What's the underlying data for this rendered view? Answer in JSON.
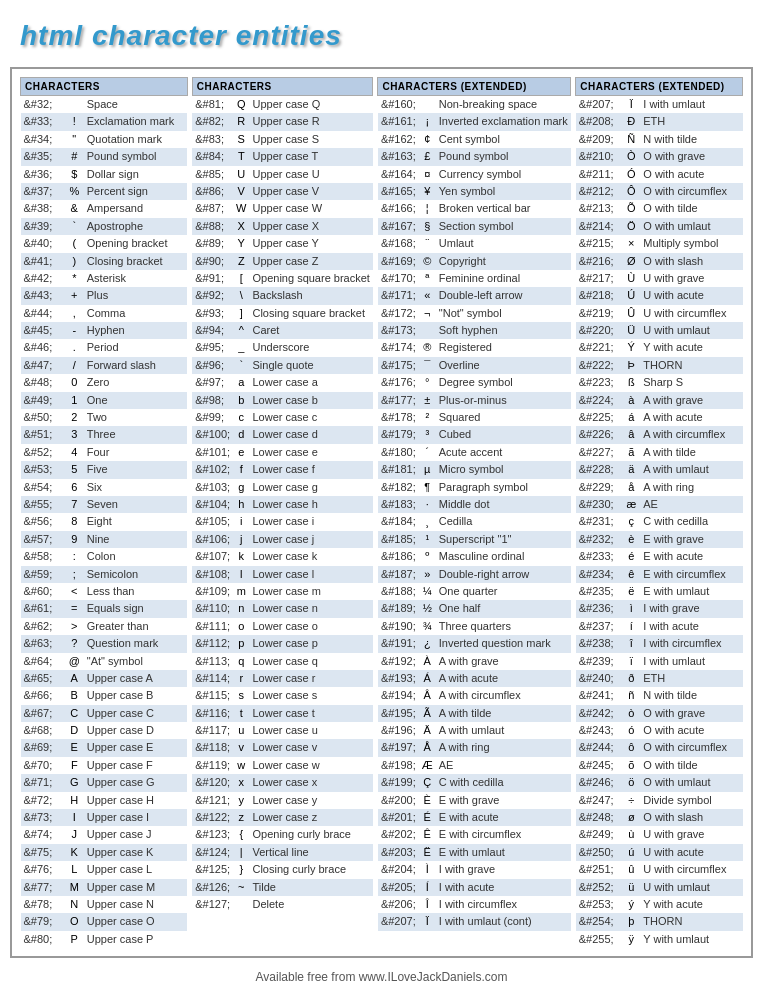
{
  "title": "html character entities",
  "footer": "Available free from www.ILoveJackDaniels.com",
  "columns": [
    {
      "header": "CHARACTERS",
      "rows": [
        [
          "&#32;",
          "",
          "Space"
        ],
        [
          "&#33;",
          "!",
          "Exclamation mark"
        ],
        [
          "&#34;",
          "\"",
          "Quotation mark"
        ],
        [
          "&#35;",
          "#",
          "Pound symbol"
        ],
        [
          "&#36;",
          "$",
          "Dollar sign"
        ],
        [
          "&#37;",
          "%",
          "Percent sign"
        ],
        [
          "&#38;",
          "&",
          "Ampersand"
        ],
        [
          "&#39;",
          "`",
          "Apostrophe"
        ],
        [
          "&#40;",
          "(",
          "Opening bracket"
        ],
        [
          "&#41;",
          ")",
          "Closing bracket"
        ],
        [
          "&#42;",
          "*",
          "Asterisk"
        ],
        [
          "&#43;",
          "+",
          "Plus"
        ],
        [
          "&#44;",
          ",",
          "Comma"
        ],
        [
          "&#45;",
          "-",
          "Hyphen"
        ],
        [
          "&#46;",
          ".",
          "Period"
        ],
        [
          "&#47;",
          "/",
          "Forward slash"
        ],
        [
          "&#48;",
          "0",
          "Zero"
        ],
        [
          "&#49;",
          "1",
          "One"
        ],
        [
          "&#50;",
          "2",
          "Two"
        ],
        [
          "&#51;",
          "3",
          "Three"
        ],
        [
          "&#52;",
          "4",
          "Four"
        ],
        [
          "&#53;",
          "5",
          "Five"
        ],
        [
          "&#54;",
          "6",
          "Six"
        ],
        [
          "&#55;",
          "7",
          "Seven"
        ],
        [
          "&#56;",
          "8",
          "Eight"
        ],
        [
          "&#57;",
          "9",
          "Nine"
        ],
        [
          "&#58;",
          ":",
          "Colon"
        ],
        [
          "&#59;",
          ";",
          "Semicolon"
        ],
        [
          "&#60;",
          "<",
          "Less than"
        ],
        [
          "&#61;",
          "=",
          "Equals sign"
        ],
        [
          "&#62;",
          ">",
          "Greater than"
        ],
        [
          "&#63;",
          "?",
          "Question mark"
        ],
        [
          "&#64;",
          "@",
          "\"At\" symbol"
        ],
        [
          "&#65;",
          "A",
          "Upper case A"
        ],
        [
          "&#66;",
          "B",
          "Upper case B"
        ],
        [
          "&#67;",
          "C",
          "Upper case C"
        ],
        [
          "&#68;",
          "D",
          "Upper case D"
        ],
        [
          "&#69;",
          "E",
          "Upper case E"
        ],
        [
          "&#70;",
          "F",
          "Upper case F"
        ],
        [
          "&#71;",
          "G",
          "Upper case G"
        ],
        [
          "&#72;",
          "H",
          "Upper case H"
        ],
        [
          "&#73;",
          "I",
          "Upper case I"
        ],
        [
          "&#74;",
          "J",
          "Upper case J"
        ],
        [
          "&#75;",
          "K",
          "Upper case K"
        ],
        [
          "&#76;",
          "L",
          "Upper case L"
        ],
        [
          "&#77;",
          "M",
          "Upper case M"
        ],
        [
          "&#78;",
          "N",
          "Upper case N"
        ],
        [
          "&#79;",
          "O",
          "Upper case O"
        ],
        [
          "&#80;",
          "P",
          "Upper case P"
        ]
      ]
    },
    {
      "header": "CHARACTERS",
      "rows": [
        [
          "&#81;",
          "Q",
          "Upper case Q"
        ],
        [
          "&#82;",
          "R",
          "Upper case R"
        ],
        [
          "&#83;",
          "S",
          "Upper case S"
        ],
        [
          "&#84;",
          "T",
          "Upper case T"
        ],
        [
          "&#85;",
          "U",
          "Upper case U"
        ],
        [
          "&#86;",
          "V",
          "Upper case V"
        ],
        [
          "&#87;",
          "W",
          "Upper case W"
        ],
        [
          "&#88;",
          "X",
          "Upper case X"
        ],
        [
          "&#89;",
          "Y",
          "Upper case Y"
        ],
        [
          "&#90;",
          "Z",
          "Upper case Z"
        ],
        [
          "&#91;",
          "[",
          "Opening square bracket"
        ],
        [
          "&#92;",
          "\\",
          "Backslash"
        ],
        [
          "&#93;",
          "]",
          "Closing square bracket"
        ],
        [
          "&#94;",
          "^",
          "Caret"
        ],
        [
          "&#95;",
          "_",
          "Underscore"
        ],
        [
          "&#96;",
          "`",
          "Single quote"
        ],
        [
          "&#97;",
          "a",
          "Lower case a"
        ],
        [
          "&#98;",
          "b",
          "Lower case b"
        ],
        [
          "&#99;",
          "c",
          "Lower case c"
        ],
        [
          "&#100;",
          "d",
          "Lower case d"
        ],
        [
          "&#101;",
          "e",
          "Lower case e"
        ],
        [
          "&#102;",
          "f",
          "Lower case f"
        ],
        [
          "&#103;",
          "g",
          "Lower case g"
        ],
        [
          "&#104;",
          "h",
          "Lower case h"
        ],
        [
          "&#105;",
          "i",
          "Lower case i"
        ],
        [
          "&#106;",
          "j",
          "Lower case j"
        ],
        [
          "&#107;",
          "k",
          "Lower case k"
        ],
        [
          "&#108;",
          "l",
          "Lower case l"
        ],
        [
          "&#109;",
          "m",
          "Lower case m"
        ],
        [
          "&#110;",
          "n",
          "Lower case n"
        ],
        [
          "&#111;",
          "o",
          "Lower case o"
        ],
        [
          "&#112;",
          "p",
          "Lower case p"
        ],
        [
          "&#113;",
          "q",
          "Lower case q"
        ],
        [
          "&#114;",
          "r",
          "Lower case r"
        ],
        [
          "&#115;",
          "s",
          "Lower case s"
        ],
        [
          "&#116;",
          "t",
          "Lower case t"
        ],
        [
          "&#117;",
          "u",
          "Lower case u"
        ],
        [
          "&#118;",
          "v",
          "Lower case v"
        ],
        [
          "&#119;",
          "w",
          "Lower case w"
        ],
        [
          "&#120;",
          "x",
          "Lower case x"
        ],
        [
          "&#121;",
          "y",
          "Lower case y"
        ],
        [
          "&#122;",
          "z",
          "Lower case z"
        ],
        [
          "&#123;",
          "{",
          "Opening curly brace"
        ],
        [
          "&#124;",
          "|",
          "Vertical line"
        ],
        [
          "&#125;",
          "}",
          "Closing curly brace"
        ],
        [
          "&#126;",
          "~",
          "Tilde"
        ],
        [
          "&#127;",
          "",
          "Delete"
        ]
      ]
    },
    {
      "header": "CHARACTERS (EXTENDED)",
      "rows": [
        [
          "&#160;",
          "",
          "Non-breaking space"
        ],
        [
          "&#161;",
          "¡",
          "Inverted exclamation mark"
        ],
        [
          "&#162;",
          "¢",
          "Cent symbol"
        ],
        [
          "&#163;",
          "£",
          "Pound symbol"
        ],
        [
          "&#164;",
          "¤",
          "Currency symbol"
        ],
        [
          "&#165;",
          "¥",
          "Yen symbol"
        ],
        [
          "&#166;",
          "¦",
          "Broken vertical bar"
        ],
        [
          "&#167;",
          "§",
          "Section symbol"
        ],
        [
          "&#168;",
          "¨",
          "Umlaut"
        ],
        [
          "&#169;",
          "©",
          "Copyright"
        ],
        [
          "&#170;",
          "ª",
          "Feminine ordinal"
        ],
        [
          "&#171;",
          "«",
          "Double-left arrow"
        ],
        [
          "&#172;",
          "¬",
          "\"Not\" symbol"
        ],
        [
          "&#173;",
          "",
          "Soft hyphen"
        ],
        [
          "&#174;",
          "®",
          "Registered"
        ],
        [
          "&#175;",
          "¯",
          "Overline"
        ],
        [
          "&#176;",
          "°",
          "Degree symbol"
        ],
        [
          "&#177;",
          "±",
          "Plus-or-minus"
        ],
        [
          "&#178;",
          "²",
          "Squared"
        ],
        [
          "&#179;",
          "³",
          "Cubed"
        ],
        [
          "&#180;",
          "´",
          "Acute accent"
        ],
        [
          "&#181;",
          "µ",
          "Micro symbol"
        ],
        [
          "&#182;",
          "¶",
          "Paragraph symbol"
        ],
        [
          "&#183;",
          "·",
          "Middle dot"
        ],
        [
          "&#184;",
          "¸",
          "Cedilla"
        ],
        [
          "&#185;",
          "¹",
          "Superscript \"1\""
        ],
        [
          "&#186;",
          "º",
          "Masculine ordinal"
        ],
        [
          "&#187;",
          "»",
          "Double-right arrow"
        ],
        [
          "&#188;",
          "¼",
          "One quarter"
        ],
        [
          "&#189;",
          "½",
          "One half"
        ],
        [
          "&#190;",
          "¾",
          "Three quarters"
        ],
        [
          "&#191;",
          "¿",
          "Inverted question mark"
        ],
        [
          "&#192;",
          "À",
          "A with grave"
        ],
        [
          "&#193;",
          "Á",
          "A with acute"
        ],
        [
          "&#194;",
          "Â",
          "A with circumflex"
        ],
        [
          "&#195;",
          "Ã",
          "A with tilde"
        ],
        [
          "&#196;",
          "Ä",
          "A with umlaut"
        ],
        [
          "&#197;",
          "Å",
          "A with ring"
        ],
        [
          "&#198;",
          "Æ",
          "AE"
        ],
        [
          "&#199;",
          "Ç",
          "C with cedilla"
        ],
        [
          "&#200;",
          "È",
          "E with grave"
        ],
        [
          "&#201;",
          "É",
          "E with acute"
        ],
        [
          "&#202;",
          "Ê",
          "E with circumflex"
        ],
        [
          "&#203;",
          "Ë",
          "E with umlaut"
        ],
        [
          "&#204;",
          "Ì",
          "I with grave"
        ],
        [
          "&#205;",
          "Í",
          "I with acute"
        ],
        [
          "&#206;",
          "Î",
          "I with circumflex"
        ],
        [
          "&#207;",
          "Ï",
          "I with umlaut (cont)"
        ]
      ]
    },
    {
      "header": "CHARACTERS (EXTENDED)",
      "rows": [
        [
          "&#207;",
          "Ï",
          "I with umlaut"
        ],
        [
          "&#208;",
          "Ð",
          "ETH"
        ],
        [
          "&#209;",
          "Ñ",
          "N with tilde"
        ],
        [
          "&#210;",
          "Ò",
          "O with grave"
        ],
        [
          "&#211;",
          "Ó",
          "O with acute"
        ],
        [
          "&#212;",
          "Ô",
          "O with circumflex"
        ],
        [
          "&#213;",
          "Õ",
          "O with tilde"
        ],
        [
          "&#214;",
          "Ö",
          "O with umlaut"
        ],
        [
          "&#215;",
          "×",
          "Multiply symbol"
        ],
        [
          "&#216;",
          "Ø",
          "O with slash"
        ],
        [
          "&#217;",
          "Ù",
          "U with grave"
        ],
        [
          "&#218;",
          "Ú",
          "U with acute"
        ],
        [
          "&#219;",
          "Û",
          "U with circumflex"
        ],
        [
          "&#220;",
          "Ü",
          "U with umlaut"
        ],
        [
          "&#221;",
          "Ý",
          "Y with acute"
        ],
        [
          "&#222;",
          "Þ",
          "THORN"
        ],
        [
          "&#223;",
          "ß",
          "Sharp S"
        ],
        [
          "&#224;",
          "à",
          "A with grave"
        ],
        [
          "&#225;",
          "á",
          "A with acute"
        ],
        [
          "&#226;",
          "â",
          "A with circumflex"
        ],
        [
          "&#227;",
          "ã",
          "A with tilde"
        ],
        [
          "&#228;",
          "ä",
          "A with umlaut"
        ],
        [
          "&#229;",
          "å",
          "A with ring"
        ],
        [
          "&#230;",
          "æ",
          "AE"
        ],
        [
          "&#231;",
          "ç",
          "C with cedilla"
        ],
        [
          "&#232;",
          "è",
          "E with grave"
        ],
        [
          "&#233;",
          "é",
          "E with acute"
        ],
        [
          "&#234;",
          "ê",
          "E with circumflex"
        ],
        [
          "&#235;",
          "ë",
          "E with umlaut"
        ],
        [
          "&#236;",
          "ì",
          "I with grave"
        ],
        [
          "&#237;",
          "í",
          "I with acute"
        ],
        [
          "&#238;",
          "î",
          "I with circumflex"
        ],
        [
          "&#239;",
          "ï",
          "I with umlaut"
        ],
        [
          "&#240;",
          "ð",
          "ETH"
        ],
        [
          "&#241;",
          "ñ",
          "N with tilde"
        ],
        [
          "&#242;",
          "ò",
          "O with grave"
        ],
        [
          "&#243;",
          "ó",
          "O with acute"
        ],
        [
          "&#244;",
          "ô",
          "O with circumflex"
        ],
        [
          "&#245;",
          "õ",
          "O with tilde"
        ],
        [
          "&#246;",
          "ö",
          "O with umlaut"
        ],
        [
          "&#247;",
          "÷",
          "Divide symbol"
        ],
        [
          "&#248;",
          "ø",
          "O with slash"
        ],
        [
          "&#249;",
          "ù",
          "U with grave"
        ],
        [
          "&#250;",
          "ú",
          "U with acute"
        ],
        [
          "&#251;",
          "û",
          "U with circumflex"
        ],
        [
          "&#252;",
          "ü",
          "U with umlaut"
        ],
        [
          "&#253;",
          "ý",
          "Y with acute"
        ],
        [
          "&#254;",
          "þ",
          "THORN"
        ],
        [
          "&#255;",
          "ÿ",
          "Y with umlaut"
        ]
      ]
    }
  ]
}
